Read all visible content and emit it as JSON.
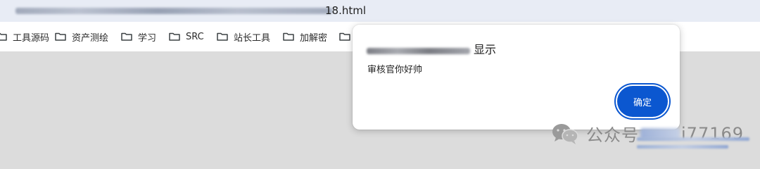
{
  "address_bar": {
    "url_visible_tail": "18.html"
  },
  "bookmarks": [
    {
      "label": "工具源码"
    },
    {
      "label": "资产测绘"
    },
    {
      "label": "学习"
    },
    {
      "label": "SRC"
    },
    {
      "label": "站长工具"
    },
    {
      "label": "加解密"
    },
    {
      "label": ""
    }
  ],
  "dialog": {
    "title_suffix": "显示",
    "message": "审核官你好帅",
    "ok_label": "确定"
  },
  "watermark": {
    "text": "公众号",
    "handle_tail": "i77169"
  },
  "colors": {
    "accent": "#0b57d0",
    "page_bg": "#dcdcdc",
    "address_bar_bg": "#e8ecf5"
  },
  "icons": {
    "bookmark": "folder-icon",
    "watermark": "wechat-icon"
  }
}
